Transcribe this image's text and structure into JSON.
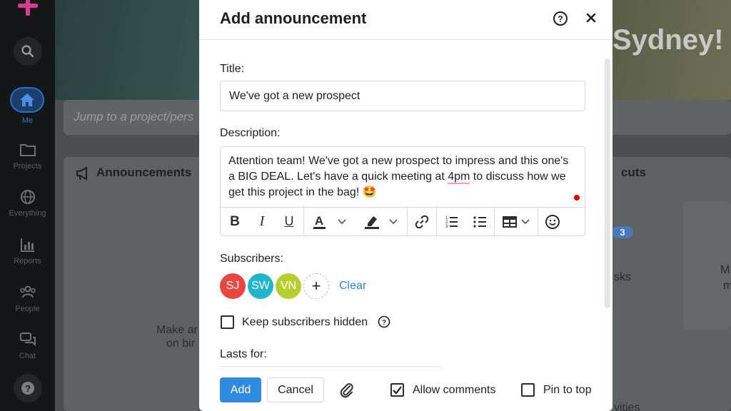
{
  "nav": {
    "items": [
      {
        "label": "Me"
      },
      {
        "label": "Projects"
      },
      {
        "label": "Everything"
      },
      {
        "label": "Reports"
      },
      {
        "label": "People"
      },
      {
        "label": "Chat"
      }
    ]
  },
  "background": {
    "city_text": "Sydney!",
    "jump_placeholder": "Jump to a project/pers",
    "announcements_title": "Announcements",
    "announcements_note_line1": "Make ar",
    "announcements_note_line2": "on bir",
    "shortcuts_title": "cuts",
    "shortcuts_badge": "3",
    "tasks_text": "sks",
    "activities_text": "vities",
    "subcard_text_1": "M",
    "subcard_text_2": "m"
  },
  "modal": {
    "title": "Add announcement",
    "title_label": "Title:",
    "title_value": "We've got a new prospect",
    "description_label": "Description:",
    "description_part1": "Attention team! We've got a new prospect to impress and this one's a BIG DEAL. Let's have a quick meeting at ",
    "description_spell": "4pm",
    "description_part2": " to discuss how we get this project in the bag! 🤩",
    "toolbar": {
      "bold": "B",
      "italic": "I",
      "underline": "U"
    },
    "subscribers_label": "Subscribers:",
    "subscribers": [
      {
        "initials": "SJ",
        "color": "#e8473f"
      },
      {
        "initials": "SW",
        "color": "#1fb5cc"
      },
      {
        "initials": "VN",
        "color": "#b6cf2e"
      }
    ],
    "add_subscriber": "+",
    "clear_label": "Clear",
    "keep_hidden_label": "Keep subscribers hidden",
    "lasts_for_label": "Lasts for:",
    "add_button": "Add",
    "cancel_button": "Cancel",
    "allow_comments_label": "Allow comments",
    "allow_comments_checked": true,
    "pin_to_top_label": "Pin to top",
    "pin_to_top_checked": false
  },
  "colors": {
    "accent": "#2f8be0",
    "link": "#2f86d6",
    "nav_active": "#2f7ad4"
  }
}
